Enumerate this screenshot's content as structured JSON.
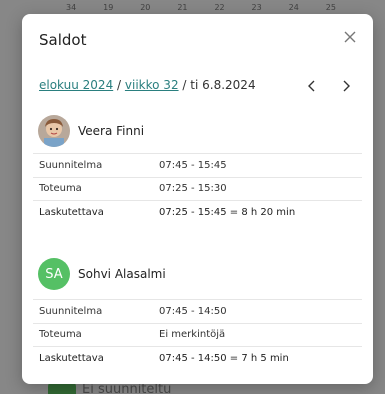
{
  "background": {
    "dates": [
      "34",
      "19",
      "20",
      "21",
      "22",
      "23",
      "24",
      "25"
    ],
    "footer_name": "Ei suunniteltu"
  },
  "modal": {
    "title": "Saldot",
    "breadcrumb": {
      "month": "elokuu 2024",
      "week": "viikko 32",
      "separator": "/",
      "day": "ti 6.8.2024"
    },
    "persons": [
      {
        "name": "Veera Finni",
        "rows": [
          {
            "label": "Suunnitelma",
            "value": "07:45 - 15:45"
          },
          {
            "label": "Toteuma",
            "value": "07:25 - 15:30"
          },
          {
            "label": "Laskutettava",
            "value": "07:25 - 15:45 = 8 h 20 min"
          }
        ]
      },
      {
        "name": "Sohvi Alasalmi",
        "initials": "SA",
        "avatar_color": "#55c065",
        "rows": [
          {
            "label": "Suunnitelma",
            "value": "07:45 - 14:50"
          },
          {
            "label": "Toteuma",
            "value": "Ei merkintöjä"
          },
          {
            "label": "Laskutettava",
            "value": "07:45 - 14:50 = 7 h 5 min"
          }
        ]
      }
    ]
  }
}
